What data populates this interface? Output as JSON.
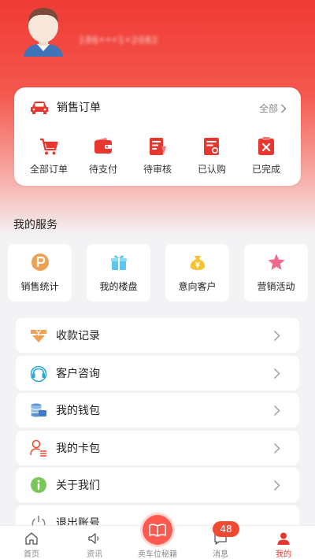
{
  "profile": {
    "username": "186•••1•2082"
  },
  "orders": {
    "title": "销售订单",
    "all_label": "全部",
    "items": [
      {
        "label": "全部订单",
        "icon": "cart-icon"
      },
      {
        "label": "待支付",
        "icon": "wallet-icon"
      },
      {
        "label": "待审核",
        "icon": "review-document-icon"
      },
      {
        "label": "已认购",
        "icon": "subscribed-receipt-icon"
      },
      {
        "label": "已完成",
        "icon": "completed-clipboard-icon"
      }
    ]
  },
  "services": {
    "title": "我的服务",
    "items": [
      {
        "label": "销售统计",
        "icon": "parking-p-icon",
        "color": "#f0a052"
      },
      {
        "label": "我的楼盘",
        "icon": "gift-icon",
        "color": "#5cc7ea"
      },
      {
        "label": "意向客户",
        "icon": "money-bag-icon",
        "color": "#f6c331"
      },
      {
        "label": "营销活动",
        "icon": "star-icon",
        "color": "#ee6a8c"
      }
    ]
  },
  "menu": [
    {
      "label": "收款记录",
      "icon": "yen-receipt-icon"
    },
    {
      "label": "客户咨询",
      "icon": "consult-icon"
    },
    {
      "label": "我的钱包",
      "icon": "wallet-coins-icon"
    },
    {
      "label": "我的卡包",
      "icon": "card-pack-icon"
    },
    {
      "label": "关于我们",
      "icon": "info-icon"
    },
    {
      "label": "退出账号",
      "icon": "power-icon"
    }
  ],
  "tabbar": {
    "items": [
      {
        "label": "首页",
        "icon": "home-icon"
      },
      {
        "label": "资讯",
        "icon": "speaker-icon"
      },
      {
        "label": "卖车位秘籍",
        "icon": "book-icon"
      },
      {
        "label": "消息",
        "icon": "message-icon",
        "badge": "48"
      },
      {
        "label": "我的",
        "icon": "user-icon",
        "active": true
      }
    ]
  },
  "colors": {
    "brand_red": "#e8372f",
    "background": "#f3f3f5"
  }
}
